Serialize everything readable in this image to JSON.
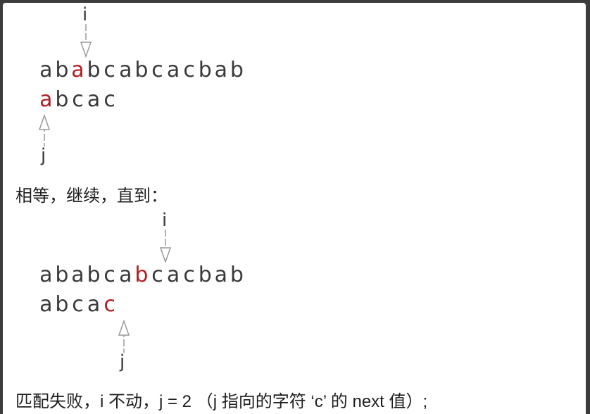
{
  "diagram1": {
    "text": [
      "a",
      "b",
      "a",
      "b",
      "c",
      "a",
      "b",
      "c",
      "a",
      "c",
      "b",
      "a",
      "b"
    ],
    "text_highlight": 2,
    "pattern": [
      "a",
      "b",
      "c",
      "a",
      "c"
    ],
    "pattern_highlight": 0,
    "i_label": "i",
    "j_label": "j"
  },
  "caption1": "相等，继续，直到：",
  "diagram2": {
    "text": [
      "a",
      "b",
      "a",
      "b",
      "c",
      "a",
      "b",
      "c",
      "a",
      "c",
      "b",
      "a",
      "b"
    ],
    "text_highlight": 6,
    "pattern": [
      "a",
      "b",
      "c",
      "a",
      "c"
    ],
    "pattern_highlight": 4,
    "i_label": "i",
    "j_label": "j"
  },
  "caption2": "匹配失败，i 不动，j = 2 （j 指向的字符 ‘c’ 的 next 值）;",
  "colors": {
    "highlight": "#b01e23",
    "text": "#3a3a3a",
    "arrow": "#9a9a9a"
  }
}
